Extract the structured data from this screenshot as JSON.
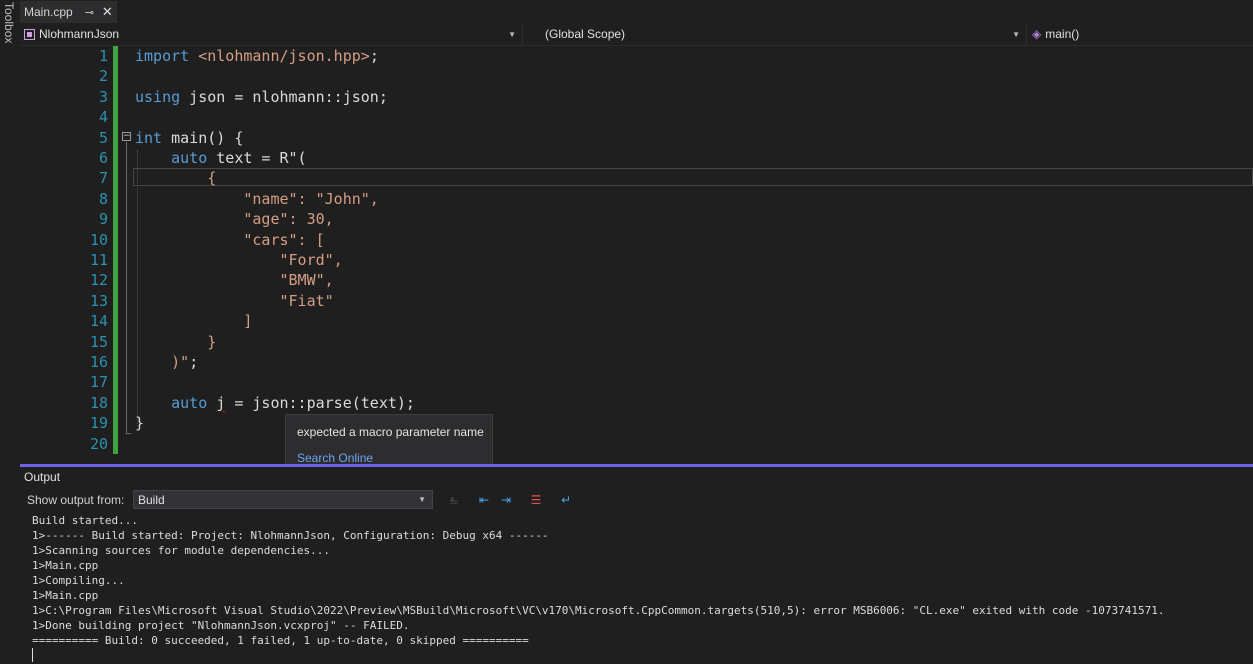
{
  "toolbox": {
    "label": "Toolbox"
  },
  "tab": {
    "title": "Main.cpp",
    "pin_glyph": "⊸",
    "close_glyph": "✕"
  },
  "navbar": {
    "project": "NlohmannJson",
    "scope": "(Global Scope)",
    "member": "main()"
  },
  "editor": {
    "line_numbers": [
      "1",
      "2",
      "3",
      "4",
      "5",
      "6",
      "7",
      "8",
      "9",
      "10",
      "11",
      "12",
      "13",
      "14",
      "15",
      "16",
      "17",
      "18",
      "19",
      "20"
    ],
    "lines": [
      [
        {
          "t": "import",
          "c": "kw"
        },
        {
          "t": " "
        },
        {
          "t": "<nlohmann/json.hpp>",
          "c": "str"
        },
        {
          "t": ";"
        }
      ],
      [],
      [
        {
          "t": "using",
          "c": "kw"
        },
        {
          "t": " json = nlohmann::json;"
        }
      ],
      [],
      [
        {
          "t": "int",
          "c": "kw"
        },
        {
          "t": " main() {"
        }
      ],
      [
        {
          "t": "    "
        },
        {
          "t": "auto",
          "c": "kw"
        },
        {
          "t": " text = R\"("
        }
      ],
      [
        {
          "t": "        {",
          "c": "str"
        }
      ],
      [
        {
          "t": "            \"name\": \"John\",",
          "c": "str"
        }
      ],
      [
        {
          "t": "            \"age\": 30,",
          "c": "str"
        }
      ],
      [
        {
          "t": "            \"cars\": [",
          "c": "str"
        }
      ],
      [
        {
          "t": "                \"Ford\",",
          "c": "str"
        }
      ],
      [
        {
          "t": "                \"BMW\",",
          "c": "str"
        }
      ],
      [
        {
          "t": "                \"Fiat\"",
          "c": "str"
        }
      ],
      [
        {
          "t": "            ]",
          "c": "str"
        }
      ],
      [
        {
          "t": "        }",
          "c": "str"
        }
      ],
      [
        {
          "t": "    )\"",
          "c": "str"
        },
        {
          "t": ";"
        }
      ],
      [],
      [
        {
          "t": "    "
        },
        {
          "t": "auto",
          "c": "kw"
        },
        {
          "t": " "
        },
        {
          "t": "j",
          "c": "squig"
        },
        {
          "t": " = json::parse(text);"
        }
      ],
      [
        {
          "t": "}"
        }
      ],
      []
    ]
  },
  "tooltip": {
    "message": "expected a macro parameter name",
    "link": "Search Online"
  },
  "output": {
    "title": "Output",
    "show_label": "Show output from:",
    "source": "Build",
    "lines": [
      "Build started...",
      "1>------ Build started: Project: NlohmannJson, Configuration: Debug x64 ------",
      "1>Scanning sources for module dependencies...",
      "1>Main.cpp",
      "1>Compiling...",
      "1>Main.cpp",
      "1>C:\\Program Files\\Microsoft Visual Studio\\2022\\Preview\\MSBuild\\Microsoft\\VC\\v170\\Microsoft.CppCommon.targets(510,5): error MSB6006: \"CL.exe\" exited with code -1073741571.",
      "1>Done building project \"NlohmannJson.vcxproj\" -- FAILED.",
      "========== Build: 0 succeeded, 1 failed, 1 up-to-date, 0 skipped =========="
    ]
  },
  "colors": {
    "keyword": "#569cd6",
    "string": "#d69d85",
    "line_number": "#2b91af",
    "change_bar": "#3fa33f",
    "panel_accent": "#7160e8",
    "error_squiggle": "#e51400"
  }
}
